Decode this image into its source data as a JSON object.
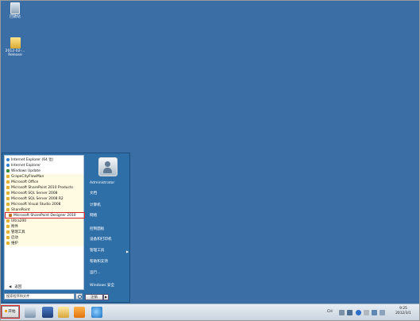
{
  "desktop": {
    "icons": [
      {
        "label": "回收站"
      },
      {
        "label": "2012-02-... Release"
      }
    ]
  },
  "start_menu": {
    "programs": [
      {
        "label": "Internet Explorer (64 位)",
        "icon": "ie-icon"
      },
      {
        "label": "Internet Explorer",
        "icon": "ie-icon"
      },
      {
        "label": "Windows Update",
        "icon": "update-icon"
      },
      {
        "label": "GrapeCityFlowMan",
        "icon": "folder-icon"
      },
      {
        "label": "Microsoft Office",
        "icon": "folder-icon"
      },
      {
        "label": "Microsoft SharePoint 2010 Products",
        "icon": "folder-icon"
      },
      {
        "label": "Microsoft SQL Server 2008",
        "icon": "folder-icon"
      },
      {
        "label": "Microsoft SQL Server 2008 R2",
        "icon": "folder-icon"
      },
      {
        "label": "Microsoft Visual Studio 2008",
        "icon": "folder-icon"
      },
      {
        "label": "SharePoint",
        "icon": "folder-icon"
      },
      {
        "label": "Microsoft SharePoint Designer 2010",
        "icon": "sharepoint-icon"
      },
      {
        "label": "Ultra200",
        "icon": "folder-icon"
      },
      {
        "label": "附件",
        "icon": "folder-icon"
      },
      {
        "label": "管理工具",
        "icon": "folder-icon"
      },
      {
        "label": "启动",
        "icon": "folder-icon"
      },
      {
        "label": "维护",
        "icon": "folder-icon"
      }
    ],
    "back_label": "返回",
    "search_placeholder": "搜索程序和文件",
    "right_items": [
      {
        "label": "Administrator"
      },
      {
        "label": "文档"
      },
      {
        "label": "计算机"
      },
      {
        "label": "网络"
      },
      {
        "label": "控制面板"
      },
      {
        "label": "设备和打印机"
      },
      {
        "label": "管理工具"
      },
      {
        "label": "帮助和支持"
      },
      {
        "label": "运行..."
      },
      {
        "label": "Windows 安全"
      }
    ],
    "shutdown_label": "注销"
  },
  "taskbar": {
    "start_label": "开始",
    "pinned": [
      "server-manager-icon",
      "powershell-icon",
      "explorer-icon",
      "tools-icon",
      "ie-icon"
    ],
    "tray": {
      "language": "CH",
      "time": "9:25",
      "date": "2012/3/1"
    }
  },
  "colors": {
    "desktop": "#3a6ea5",
    "highlight": "#d8262a"
  }
}
